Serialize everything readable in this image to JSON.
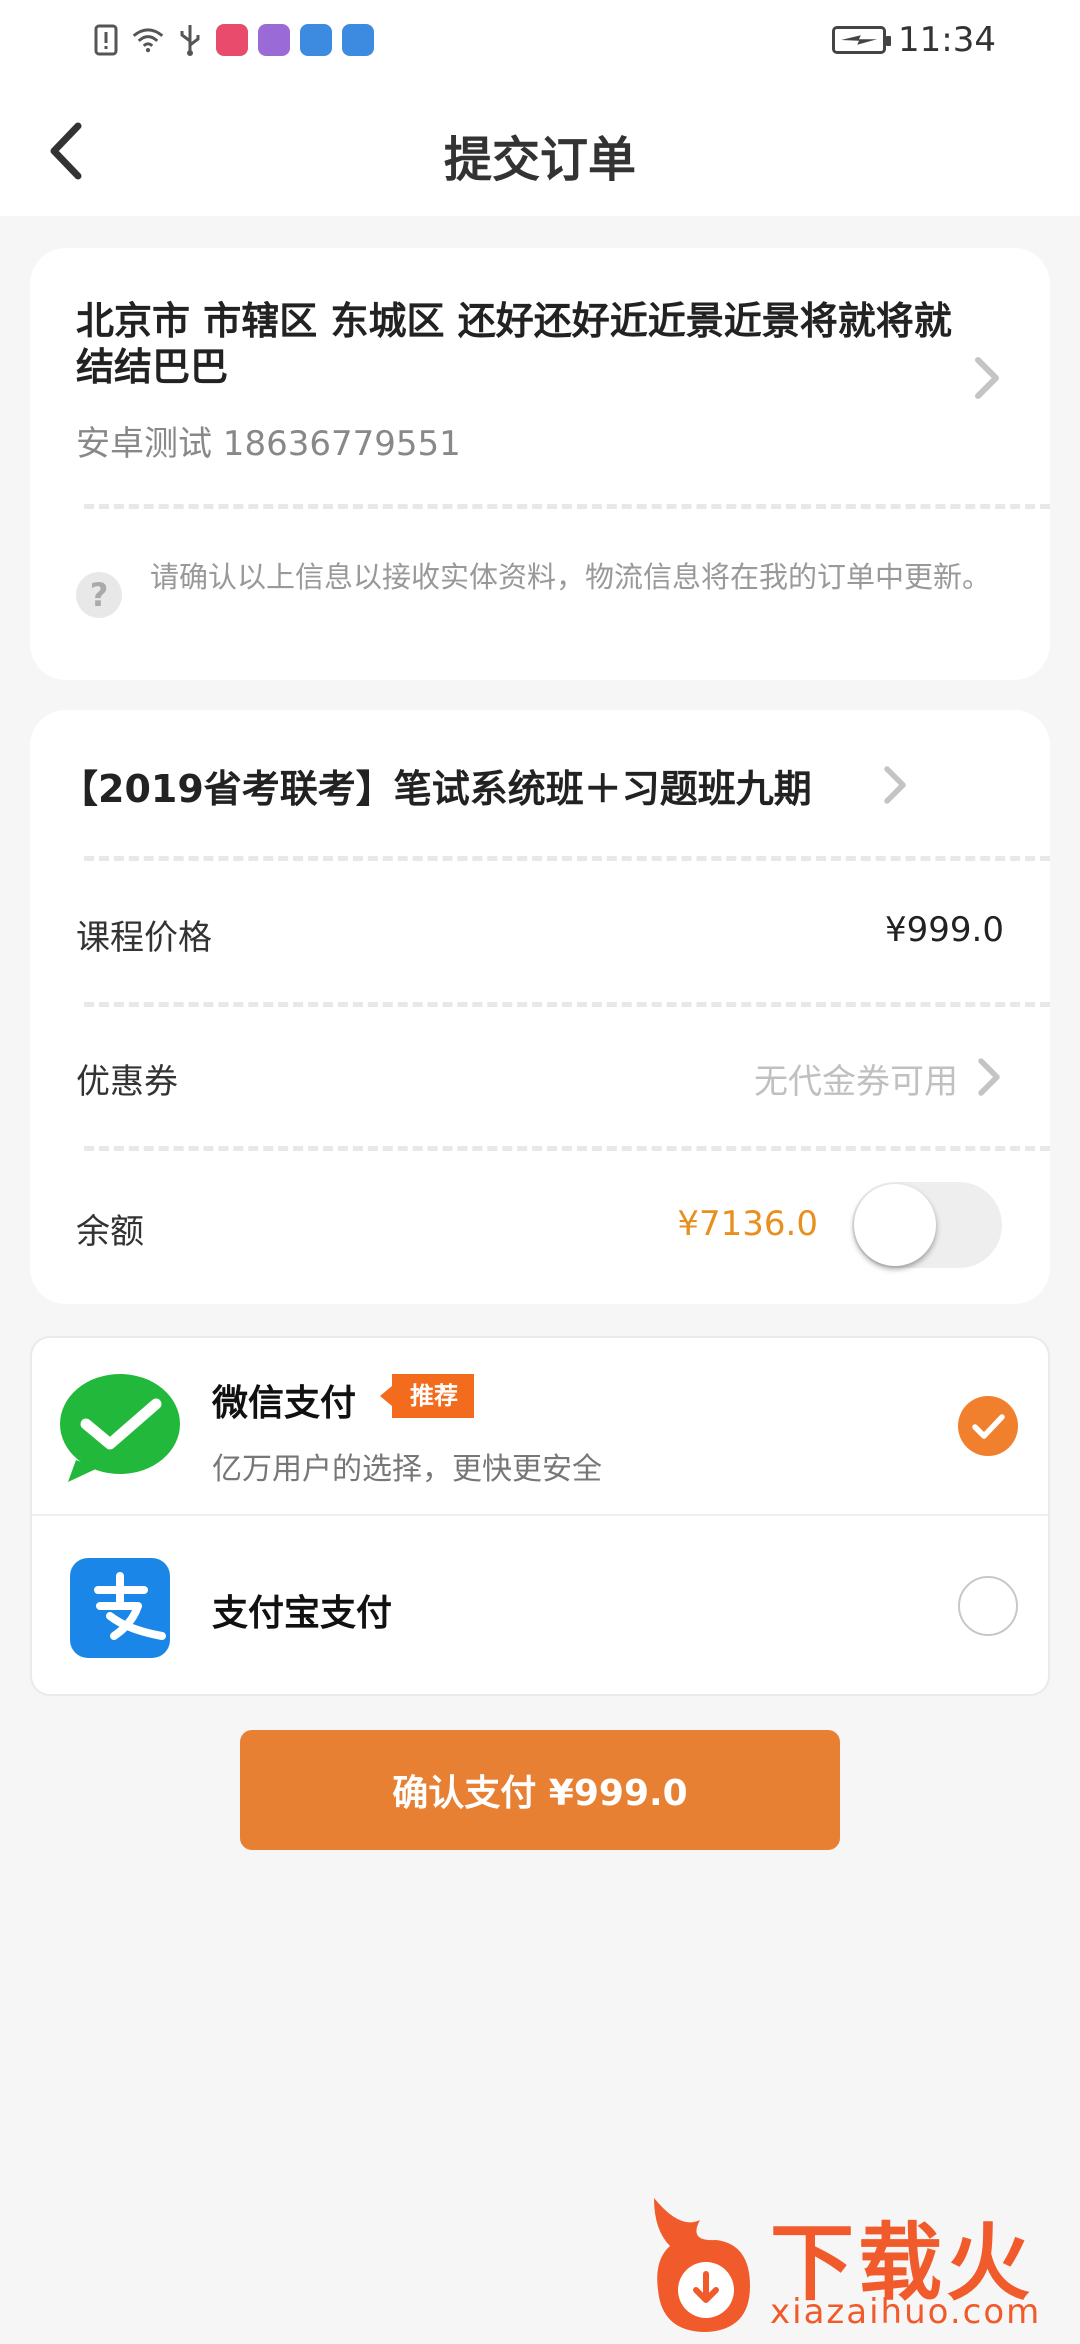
{
  "status_bar": {
    "time": "11:34",
    "icons": [
      "sim-alert-icon",
      "wifi-icon",
      "usb-icon",
      "app-icon-huawei",
      "app-icon-purple",
      "app-icon-blue",
      "app-icon-shield"
    ],
    "app_icon_colors": [
      "#e84b6b",
      "#9a6bd6",
      "#3d8be0",
      "#3d8be0"
    ]
  },
  "header": {
    "title": "提交订单",
    "back_icon": "chevron-left-icon"
  },
  "address": {
    "line": "北京市 市辖区 东城区 还好还好近近景近景将就将就结结巴巴",
    "contact": "安卓测试  18636779551",
    "hint": "请确认以上信息以接收实体资料，物流信息将在我的订单中更新。",
    "hint_icon": "question-icon"
  },
  "order": {
    "course_title": "【2019省考联考】笔试系统班＋习题班九期",
    "price_label": "课程价格",
    "price_value": "¥999.0",
    "coupon_label": "优惠券",
    "coupon_value": "无代金券可用",
    "balance_label": "余额",
    "balance_value": "¥7136.0",
    "balance_toggle_on": false
  },
  "payment": {
    "methods": [
      {
        "name": "微信支付",
        "tag": "推荐",
        "desc": "亿万用户的选择，更快更安全",
        "selected": true,
        "icon": "wechat-pay-icon"
      },
      {
        "name": "支付宝支付",
        "selected": false,
        "icon": "alipay-icon"
      }
    ]
  },
  "confirm_button": "确认支付 ¥999.0",
  "watermark": {
    "brand": "下载火",
    "url": "xiazaihuo.com"
  },
  "colors": {
    "accent": "#e88034",
    "balance": "#e8901f",
    "tag": "#f36b1c",
    "wechat": "#22b83b",
    "alipay": "#1a87e8"
  }
}
